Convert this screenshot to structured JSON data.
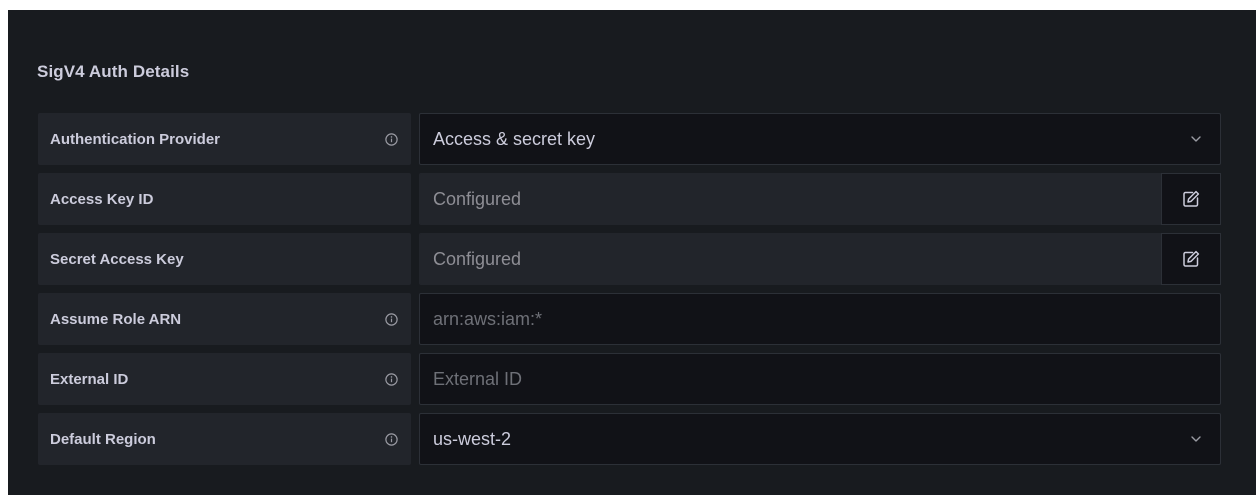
{
  "section": {
    "title": "SigV4 Auth Details"
  },
  "fields": {
    "auth_provider": {
      "label": "Authentication Provider",
      "value": "Access & secret key"
    },
    "access_key_id": {
      "label": "Access Key ID",
      "placeholder": "Configured"
    },
    "secret_access_key": {
      "label": "Secret Access Key",
      "placeholder": "Configured"
    },
    "assume_role_arn": {
      "label": "Assume Role ARN",
      "placeholder": "arn:aws:iam:*"
    },
    "external_id": {
      "label": "External ID",
      "placeholder": "External ID"
    },
    "default_region": {
      "label": "Default Region",
      "value": "us-west-2"
    }
  },
  "icons": {
    "info": "info-icon",
    "chevron": "chevron-down-icon",
    "edit": "edit-icon"
  },
  "colors": {
    "panel_bg": "#181b1f",
    "label_bg": "#22252b",
    "input_bg": "#111217",
    "text": "#ccccdc",
    "placeholder": "#6e7077"
  }
}
